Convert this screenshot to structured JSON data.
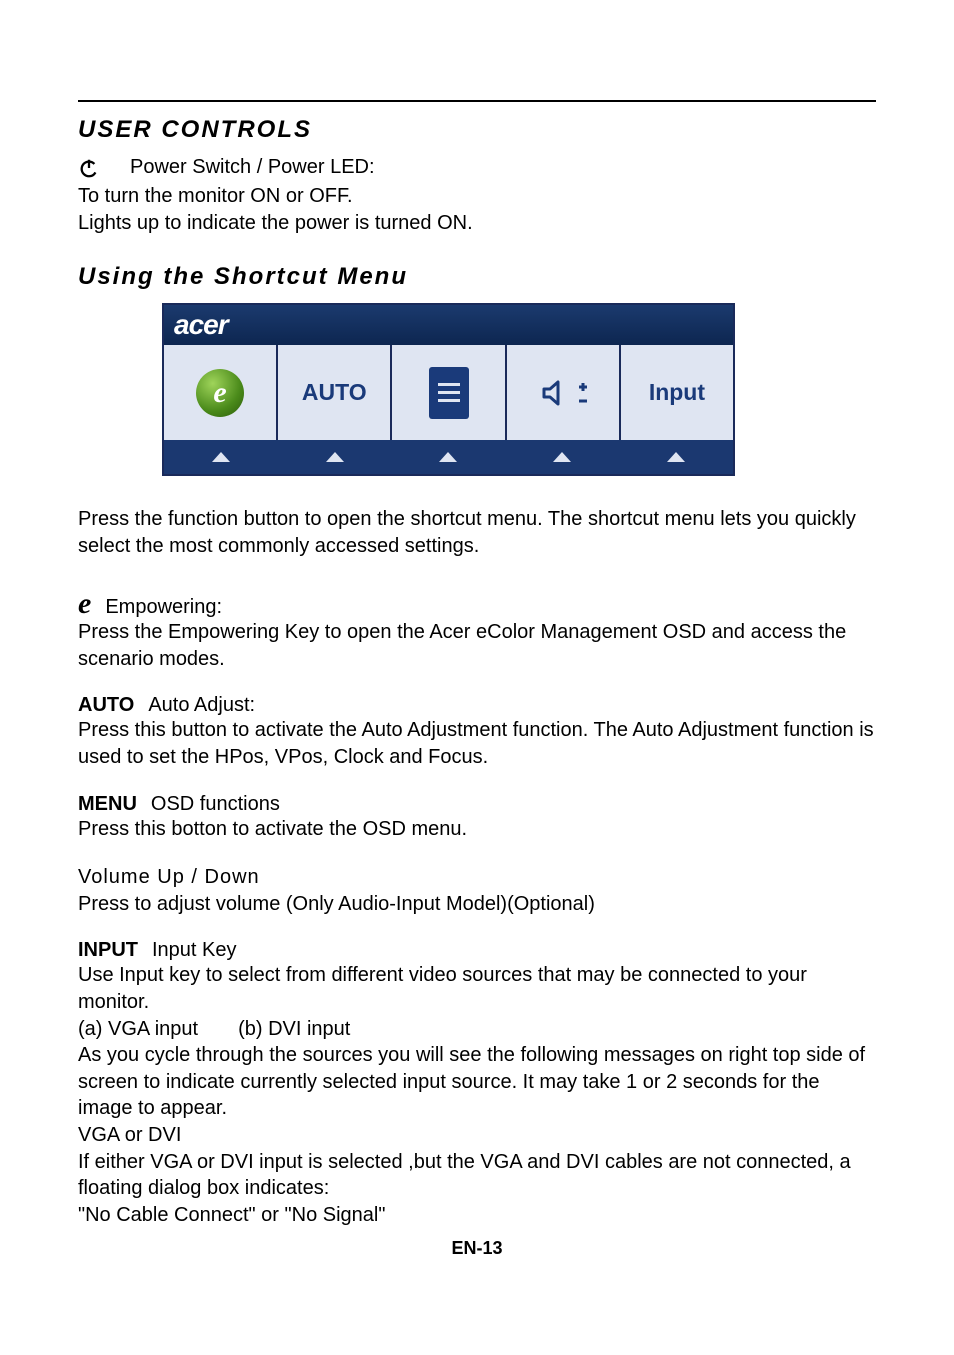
{
  "headings": {
    "user_controls": "USER CONTROLS",
    "shortcut_menu": "Using  the Shortcut Menu"
  },
  "power": {
    "title": "Power Switch / Power LED:",
    "line1": "To turn the monitor ON or OFF.",
    "line2": "Lights up to indicate the power is turned ON."
  },
  "osd": {
    "brand": "acer",
    "buttons": {
      "auto": "AUTO",
      "input": "Input"
    }
  },
  "shortcut_intro": "Press the function button to open the shortcut menu. The shortcut menu lets you quickly select the most commonly accessed settings.",
  "empowering": {
    "title": "Empowering:",
    "body": "Press the Empowering Key to open the Acer eColor Management OSD and access the scenario modes."
  },
  "auto": {
    "label": "AUTO",
    "title": "Auto Adjust:",
    "body": "Press this button to activate the Auto Adjustment function. The Auto Adjustment function is used to set the HPos, VPos, Clock and Focus."
  },
  "menu": {
    "label": "MENU",
    "title": "OSD functions",
    "body": "Press this botton to activate the OSD menu."
  },
  "volume": {
    "title": "Volume Up / Down",
    "body": " Press to adjust volume (Only Audio-Input Model)(Optional)"
  },
  "input": {
    "label": "INPUT",
    "title": "Input Key",
    "line1": "Use Input key to select from different video sources that may be connected to your monitor.",
    "opt_a": "(a) VGA input",
    "opt_b": "(b) DVI input",
    "line2": "As you cycle through the sources you will see the following messages on right top side of screen to indicate currently selected input source. It may take 1 or 2 seconds for the image to appear.",
    "line3": "VGA  or  DVI",
    "line4": "If either VGA or DVI input is selected ,but the VGA and DVI cables are not connected, a floating dialog box indicates:",
    "line5": "\"No Cable Connect\" or \"No Signal\""
  },
  "page_number": "EN-13"
}
